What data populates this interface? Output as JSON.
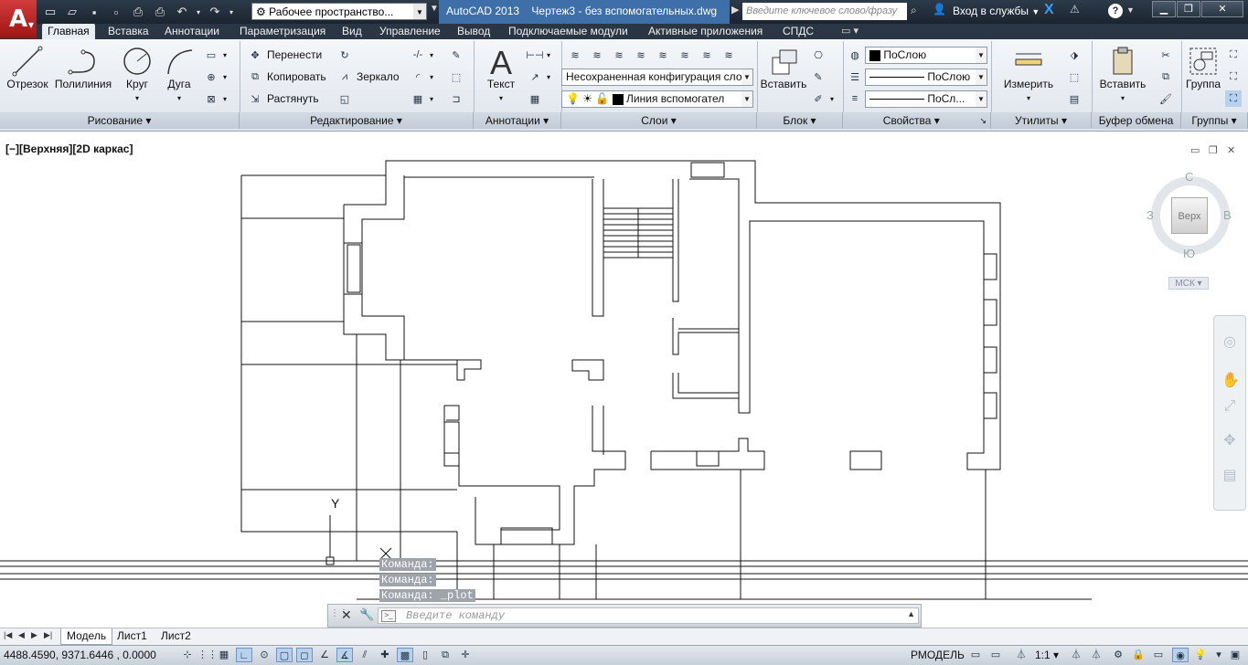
{
  "title_bar": {
    "logo_letter": "A",
    "workspace": "Рабочее пространство...",
    "app_name": "AutoCAD 2013",
    "document": "Чертеж3 - без вспомогательных.dwg",
    "search_placeholder": "Введите ключевое слово/фразу",
    "login": "Вход в службы"
  },
  "tabs": [
    "Главная",
    "Вставка",
    "Аннотации",
    "Параметризация",
    "Вид",
    "Управление",
    "Вывод",
    "Подключаемые модули",
    "Активные приложения",
    "СПДС"
  ],
  "ribbon": {
    "draw": {
      "line": "Отрезок",
      "polyline": "Полилиния",
      "circle": "Круг",
      "arc": "Дуга",
      "panel": "Рисование"
    },
    "modify": {
      "move": "Перенести",
      "copy": "Копировать",
      "stretch": "Растянуть",
      "mirror": "Зеркало",
      "panel": "Редактирование"
    },
    "annotation": {
      "text": "Текст",
      "panel": "Аннотации"
    },
    "layers": {
      "layer_state": "Несохраненная конфигурация сло",
      "current_layer": "Линия вспомогател",
      "panel": "Слои"
    },
    "block": {
      "insert": "Вставить",
      "panel": "Блок"
    },
    "properties": {
      "color": "ПоСлою",
      "linetype": "ПоСлою",
      "lineweight": "ПоСл...",
      "panel": "Свойства"
    },
    "utilities": {
      "measure": "Измерить",
      "panel": "Утилиты"
    },
    "clipboard": {
      "paste": "Вставить",
      "panel": "Буфер обмена"
    },
    "groups": {
      "group": "Группа",
      "panel": "Группы"
    }
  },
  "viewport": {
    "label": "[−][Верхняя][2D каркас]"
  },
  "viewcube": {
    "north": "С",
    "south": "Ю",
    "west": "З",
    "east": "В",
    "top": "Верх",
    "wcs": "МСК"
  },
  "ucs": {
    "y_label": "Y"
  },
  "command_history": [
    "Команда:",
    "Команда:",
    "Команда: _plot"
  ],
  "command_placeholder": "Введите команду",
  "layout_tabs": [
    "Модель",
    "Лист1",
    "Лист2"
  ],
  "status": {
    "coordinates": "4488.4590, 9371.6446 , 0.0000",
    "space": "РМОДЕЛЬ",
    "scale": "1:1"
  },
  "colors": {
    "title_bg": "#1b2530",
    "accent_doc": "#3f6fa8",
    "logo_red": "#c62828",
    "ribbon_bg": "#e4e9ef"
  }
}
